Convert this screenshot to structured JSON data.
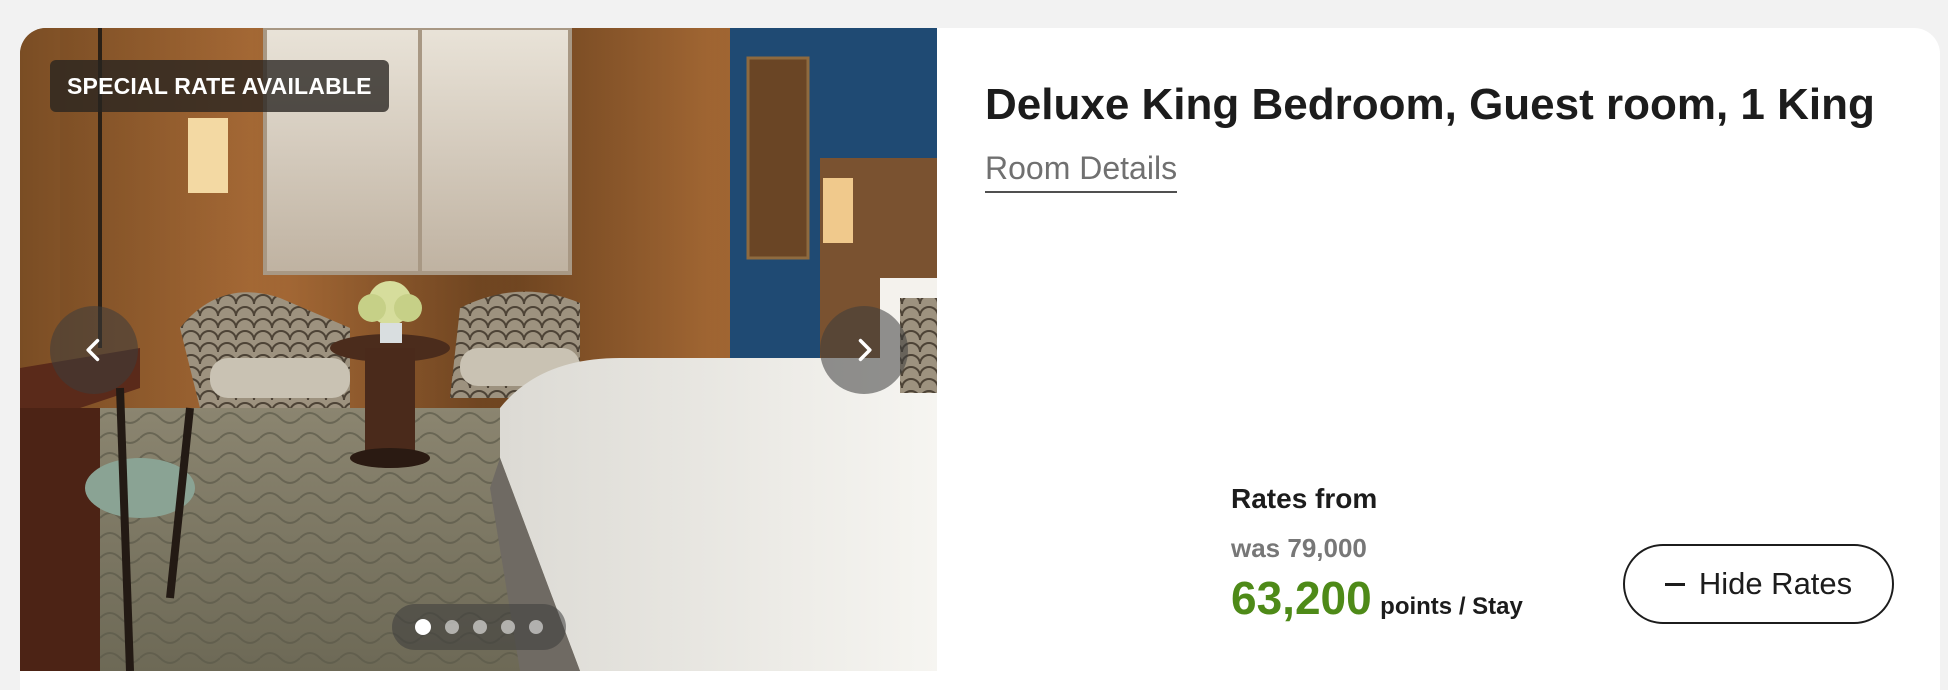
{
  "badge": {
    "text": "SPECIAL RATE AVAILABLE"
  },
  "room": {
    "title": "Deluxe King Bedroom, Guest room, 1 King",
    "details_link": "Room Details"
  },
  "gallery": {
    "prev_icon": "chevron-left-icon",
    "next_icon": "chevron-right-icon",
    "dots_total": 5,
    "active_index": 0
  },
  "rates": {
    "label": "Rates from",
    "was_price": "was 79,000",
    "price": "63,200",
    "unit": "points / Stay",
    "price_color": "#4e8a18"
  },
  "actions": {
    "hide_rates_label": "Hide Rates",
    "hide_rates_icon": "minus-icon"
  }
}
